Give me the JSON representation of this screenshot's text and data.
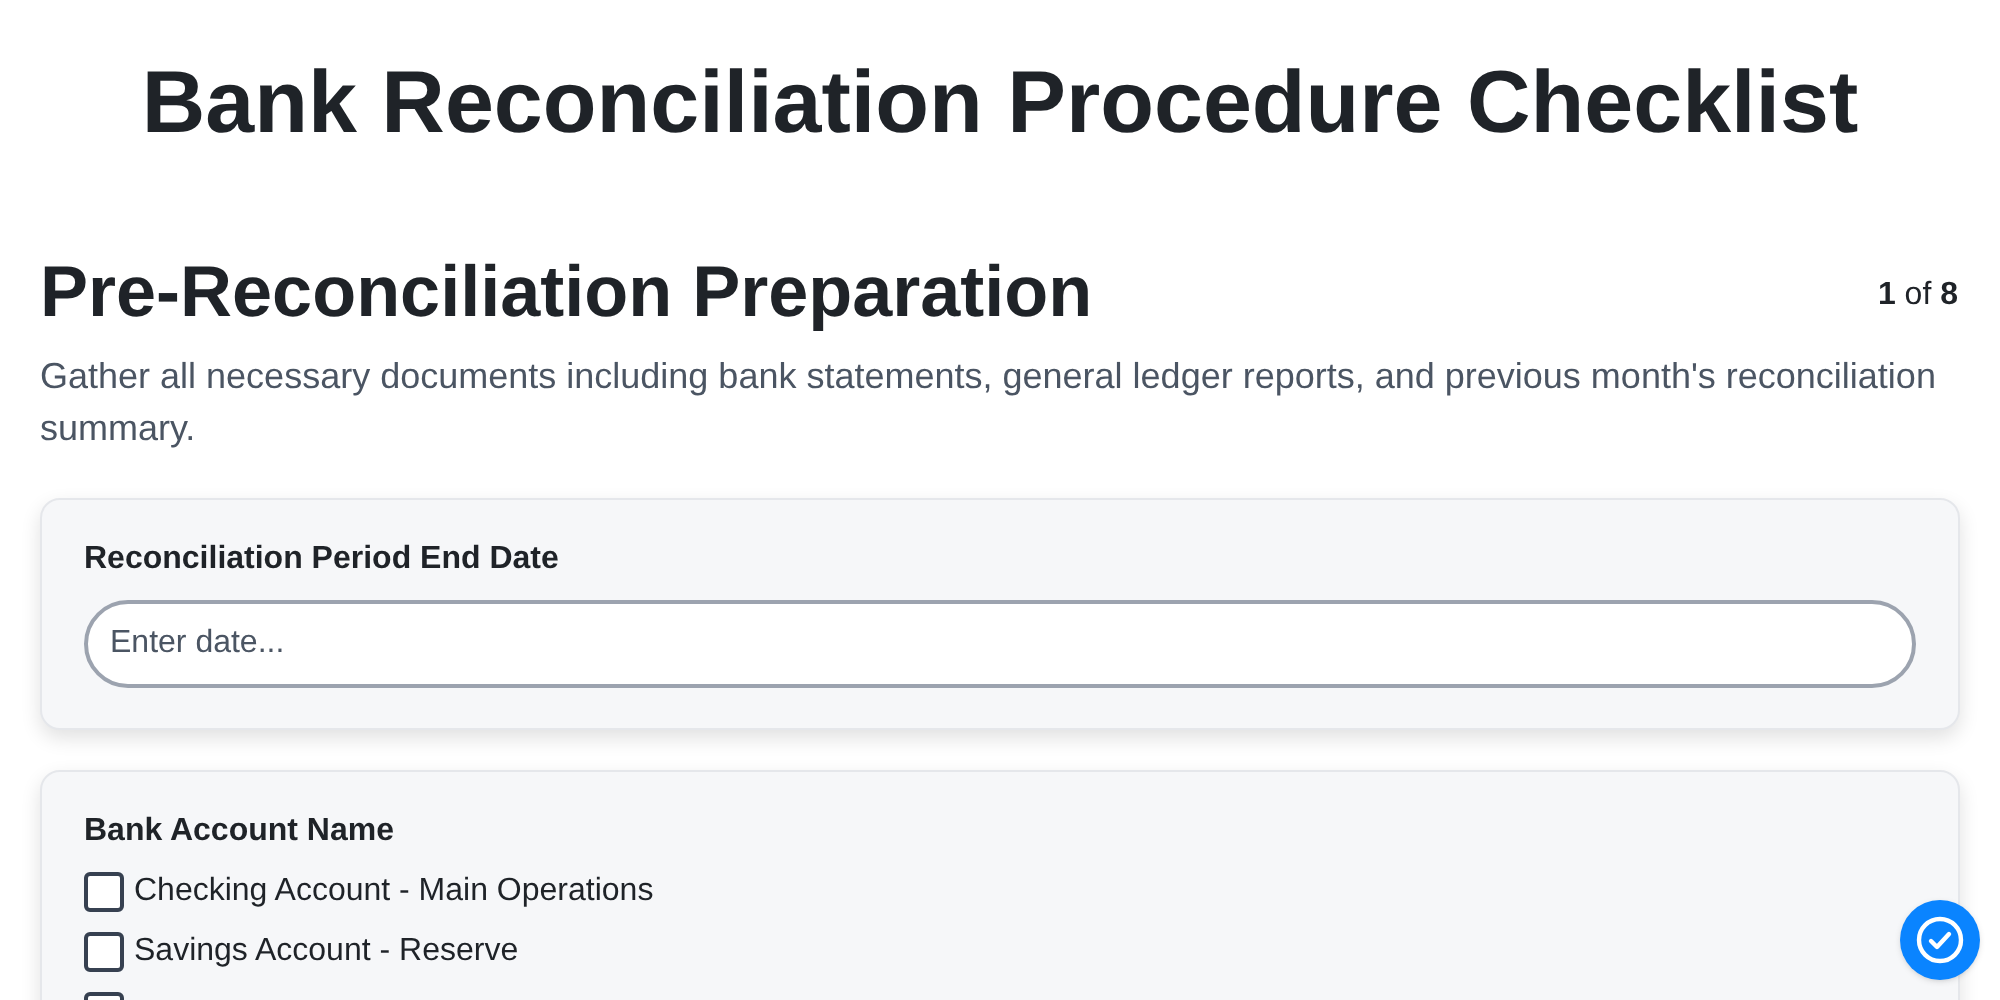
{
  "title": "Bank Reconciliation Procedure Checklist",
  "section": {
    "heading": "Pre-Reconciliation Preparation",
    "counter": "**1** of **8**",
    "description": "Gather all necessary documents including bank statements, general ledger reports, and previous month's reconciliation summary."
  },
  "fields": [
    {
      "kind": "text",
      "label": "Reconciliation Period End Date",
      "placeholder": "Enter date..."
    },
    {
      "kind": "checklist",
      "label": "Bank Account Name",
      "options": [
        {
          "label": "Checking Account - Main Operations",
          "checked": false
        },
        {
          "label": "Savings Account - Reserve",
          "checked": false
        },
        {
          "checked": false
        }
      ]
    }
  ],
  "complete_button": {
    "kind": "check"
  }
}
